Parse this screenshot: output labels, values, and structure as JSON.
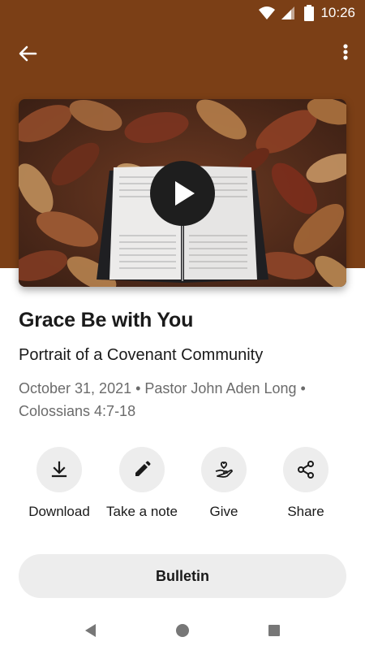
{
  "status_bar": {
    "time": "10:26",
    "icons": [
      "wifi-icon",
      "cell-signal-icon",
      "battery-icon"
    ]
  },
  "app_bar": {
    "back_icon": "arrow-back-icon",
    "menu_icon": "more-vert-icon"
  },
  "media": {
    "play_icon": "play-icon",
    "description": ""
  },
  "sermon": {
    "title": "Grace Be with You",
    "subtitle": "Portrait of a Covenant Community",
    "meta_line1": "October 31, 2021 • Pastor John Aden Long •",
    "meta_line2": "Colossians 4:7-18"
  },
  "actions": [
    {
      "label": "Download",
      "icon": "download-icon"
    },
    {
      "label": "Take a note",
      "icon": "pencil-icon"
    },
    {
      "label": "Give",
      "icon": "give-heart-hand-icon"
    },
    {
      "label": "Share",
      "icon": "share-icon"
    }
  ],
  "bulletin": {
    "label": "Bulletin"
  },
  "colors": {
    "header_brown": "#7b3f16",
    "chip_bg": "#ededed",
    "text_primary": "#1a1a1a",
    "text_secondary": "#6b6b6b"
  },
  "system_nav": [
    "nav-back-icon",
    "nav-home-icon",
    "nav-recents-icon"
  ]
}
